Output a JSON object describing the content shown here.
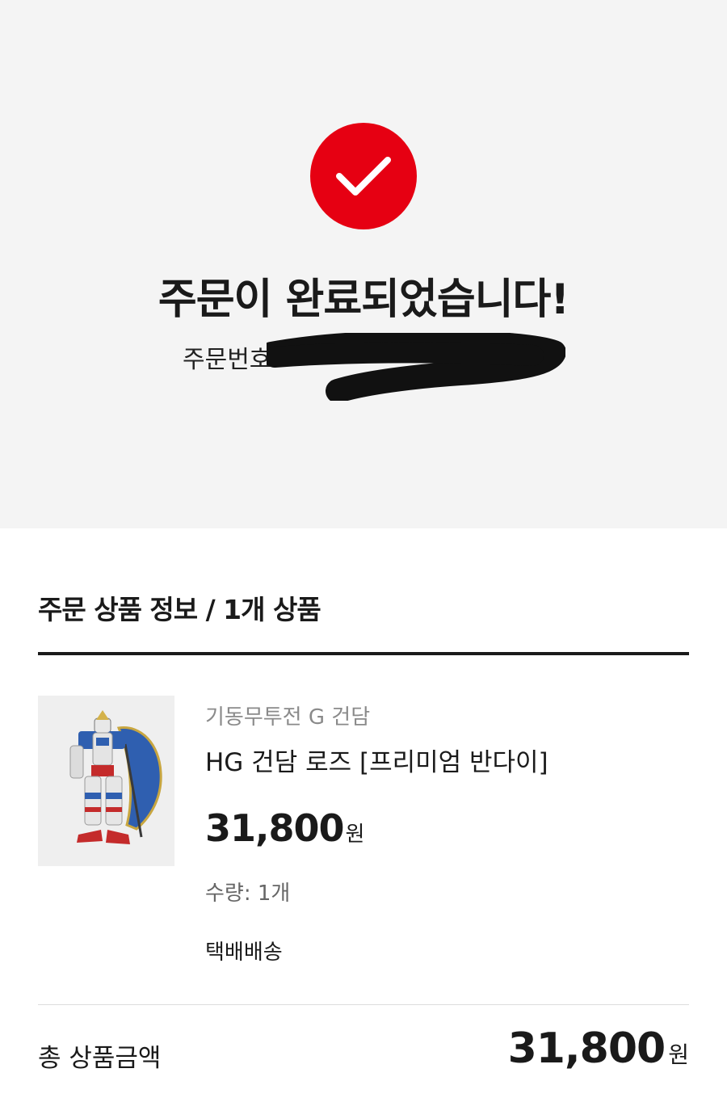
{
  "completion": {
    "title": "주문이 완료되었습니다!",
    "order_number_label": "주문번호",
    "accent_color": "#e60012",
    "icon": "check-icon"
  },
  "order_items": {
    "section_title": "주문 상품 정보 / 1개 상품",
    "items": [
      {
        "series": "기동무투전 G 건담",
        "name": "HG 건담 로즈 [프리미엄 반다이]",
        "price": "31,800",
        "currency": "원",
        "quantity_text": "수량: 1개",
        "shipping": "택배배송"
      }
    ]
  },
  "summary": {
    "total_label": "총 상품금액",
    "total_price": "31,800",
    "currency": "원"
  }
}
